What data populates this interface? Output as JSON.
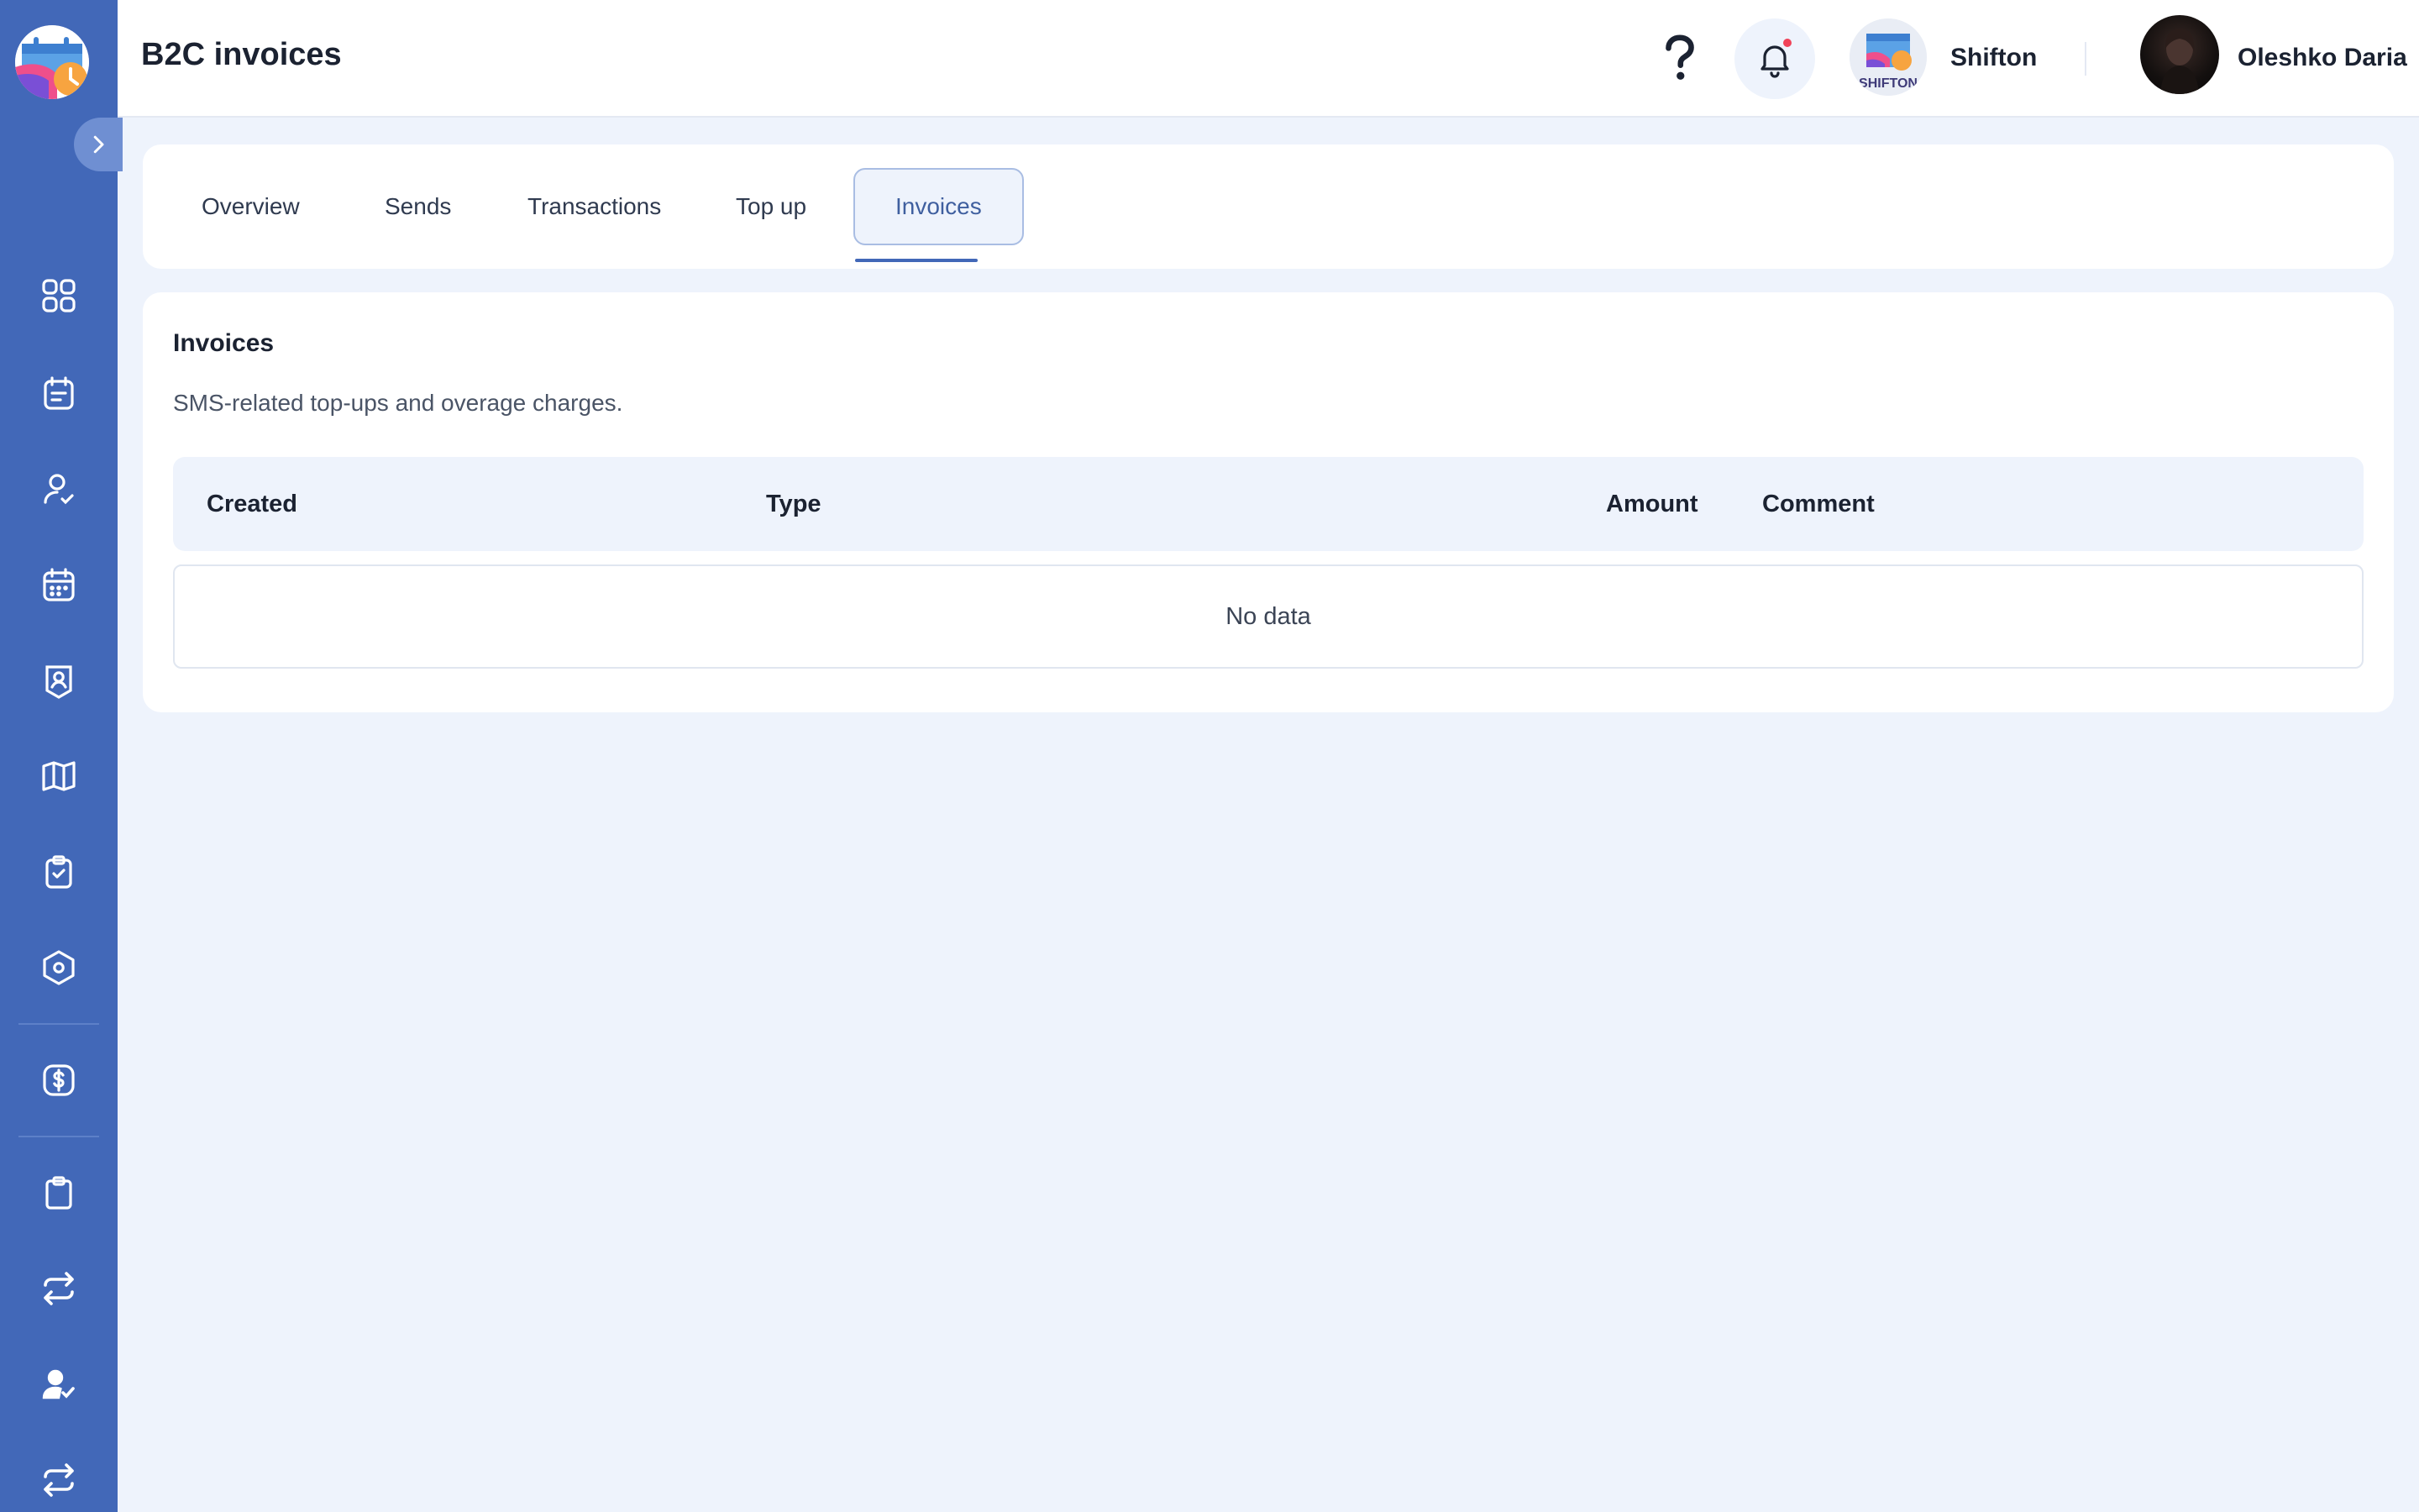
{
  "header": {
    "title": "B2C invoices",
    "company_name": "Shifton",
    "company_logo_text": "SHIFTON",
    "user_name": "Oleshko Daria"
  },
  "sidebar": {
    "items": [
      {
        "icon": "dashboard-grid-icon"
      },
      {
        "icon": "calendar-notes-icon"
      },
      {
        "icon": "user-check-icon"
      },
      {
        "icon": "calendar-icon"
      },
      {
        "icon": "badge-user-icon"
      },
      {
        "icon": "map-icon"
      },
      {
        "icon": "clipboard-check-icon"
      },
      {
        "icon": "settings-hex-icon"
      },
      {
        "icon": "dollar-icon"
      },
      {
        "icon": "clipboard-icon"
      },
      {
        "icon": "repeat-icon"
      },
      {
        "icon": "user-approve-icon"
      },
      {
        "icon": "repeat-icon"
      }
    ]
  },
  "tabs": [
    {
      "label": "Overview",
      "active": false
    },
    {
      "label": "Sends",
      "active": false
    },
    {
      "label": "Transactions",
      "active": false
    },
    {
      "label": "Top up",
      "active": false
    },
    {
      "label": "Invoices",
      "active": true
    }
  ],
  "invoices": {
    "title": "Invoices",
    "description": "SMS-related top-ups and overage charges.",
    "columns": [
      "Created",
      "Type",
      "Amount",
      "Comment"
    ],
    "empty_text": "No data"
  },
  "colors": {
    "sidebar": "#4268b8",
    "background": "#eef3fc",
    "accent": "#4268b8",
    "notification_dot": "#f04258"
  }
}
